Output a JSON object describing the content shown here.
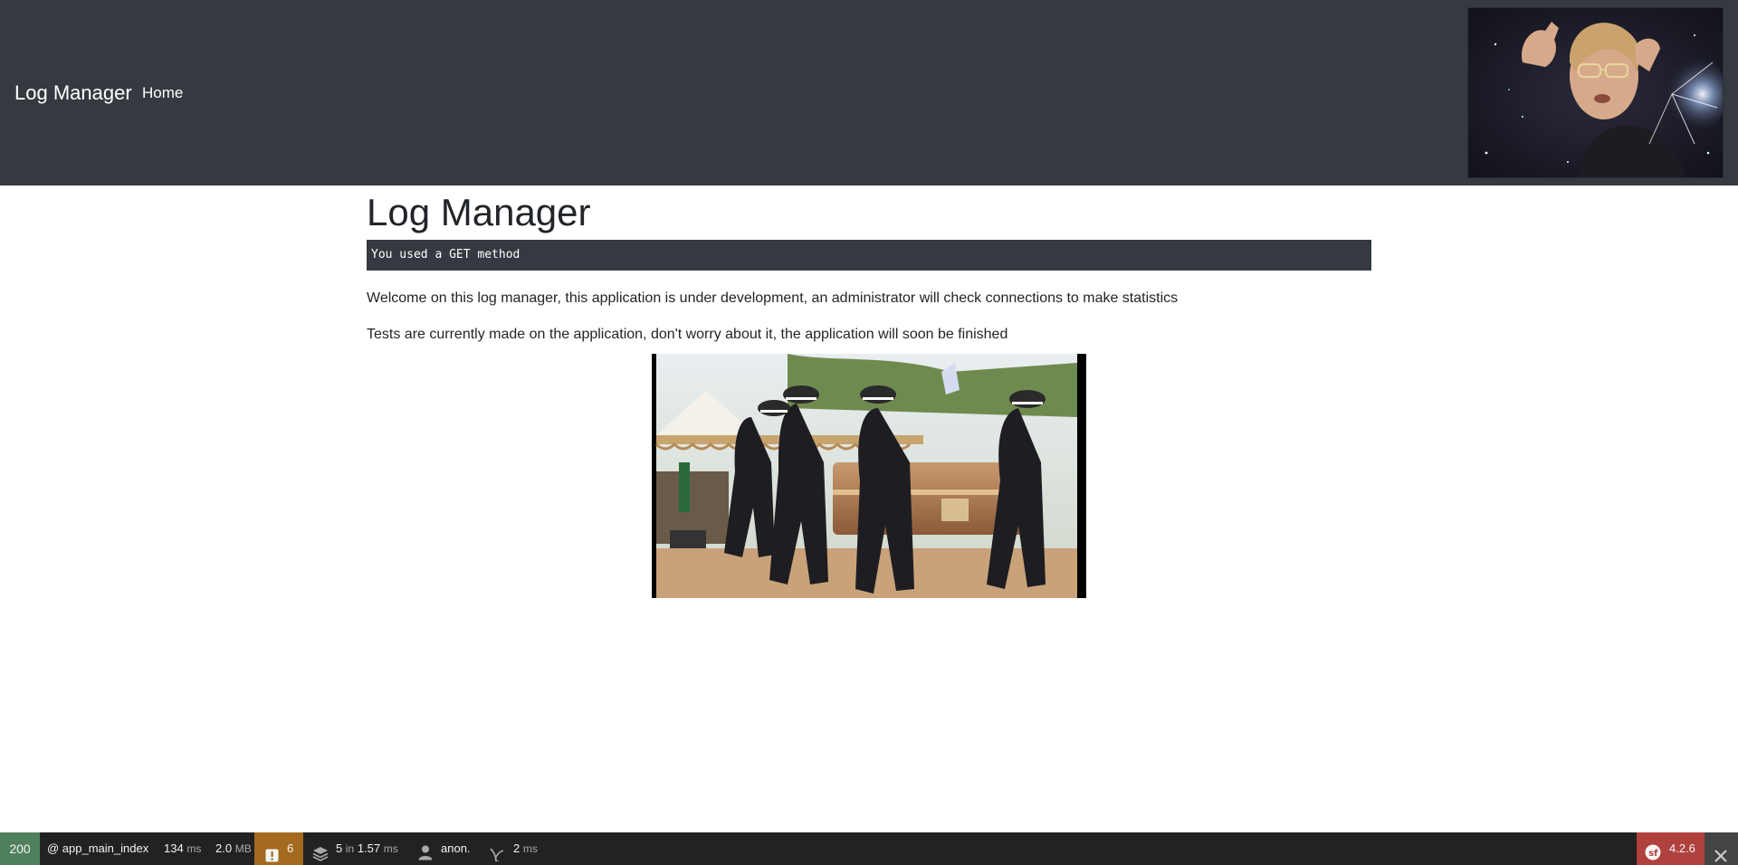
{
  "navbar": {
    "brand": "Log Manager",
    "home_label": "Home"
  },
  "main": {
    "title": "Log Manager",
    "method_text": "You used a GET method",
    "paragraphs": [
      "Welcome on this log manager, this application is under development, an administrator will check connections to make statistics",
      "Tests are currently made on the application, don't worry about it, the application will soon be finished"
    ]
  },
  "toolbar": {
    "status_code": "200",
    "route": "@ app_main_index",
    "time_value": "134",
    "time_unit": "ms",
    "memory_value": "2.0",
    "memory_unit": "MB",
    "log_count": "6",
    "cache_calls": "5",
    "cache_in": "in",
    "cache_time": "1.57",
    "cache_unit": "ms",
    "user": "anon.",
    "twig_time": "2",
    "twig_unit": "ms",
    "symfony_version": "4.2.6"
  },
  "colors": {
    "navbar_bg": "#343a40",
    "status_ok": "#4f805d",
    "log_warning": "#a46a1f",
    "symfony_brand": "#b0413e"
  },
  "icons": [
    "log-warning-icon",
    "cache-layers-icon",
    "user-icon",
    "twig-icon",
    "symfony-logo-icon",
    "close-icon"
  ]
}
